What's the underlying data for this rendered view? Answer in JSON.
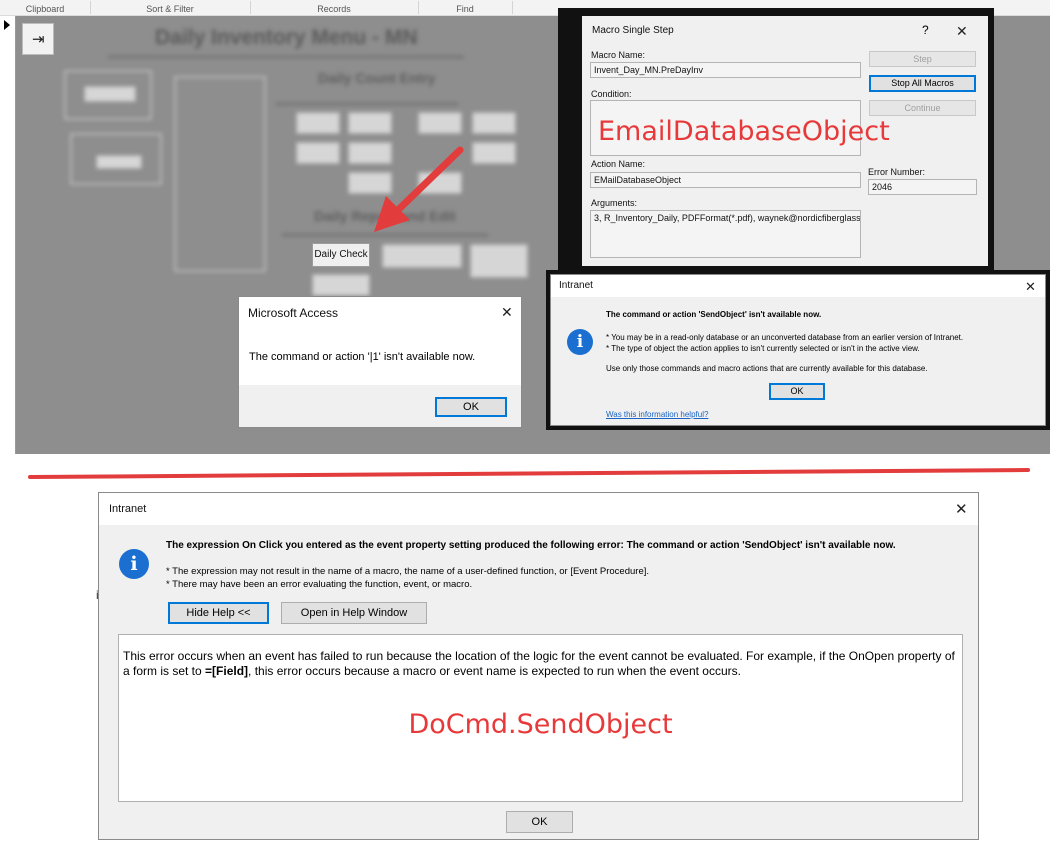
{
  "ribbon": {
    "groups": [
      "Clipboard",
      "Sort & Filter",
      "Records",
      "Find"
    ]
  },
  "access_form": {
    "title": "Daily Inventory Menu - MN",
    "daily_count_heading": "Daily Count Entry",
    "daily_report_heading": "Daily Report and Edit",
    "daily_check_label": "Daily Check"
  },
  "macro_step": {
    "title": "Macro Single Step",
    "help_glyph": "?",
    "close_glyph": "✕",
    "macro_name_label": "Macro Name:",
    "macro_name_value": "Invent_Day_MN.PreDayInv",
    "condition_label": "Condition:",
    "condition_value": "",
    "action_name_label": "Action Name:",
    "action_name_value": "EMailDatabaseObject",
    "error_number_label": "Error Number:",
    "error_number_value": "2046",
    "arguments_label": "Arguments:",
    "arguments_value": "3, R_Inventory_Daily, PDFFormat(*.pdf), waynek@nordicfiberglass",
    "step_btn": "Step",
    "stop_btn": "Stop All Macros",
    "continue_btn": "Continue",
    "annotation": "EmailDatabaseObject"
  },
  "ms_access_dialog": {
    "title": "Microsoft Access",
    "close_glyph": "✕",
    "message": "The command or action '|1' isn't available now.",
    "ok": "OK"
  },
  "intranet_small": {
    "title": "Intranet",
    "close_glyph": "✕",
    "icon_glyph": "i",
    "headline": "The command or action 'SendObject' isn't available now.",
    "bullet1": "* You may be in a read-only database or an unconverted database from an earlier version of Intranet.",
    "bullet2": "* The type of object the action applies to isn't currently selected or isn't in the active view.",
    "note": "Use only those commands and macro actions that are currently available for this database.",
    "ok": "OK",
    "help_link": "Was this information helpful?"
  },
  "intranet_large": {
    "title": "Intranet",
    "close_glyph": "✕",
    "icon_glyph": "i",
    "headline": "The expression On Click you entered as the event property setting produced the following error: The command or action 'SendObject' isn't available now.",
    "bullet1": "* The expression may not result in the name of a macro, the name of a user-defined function, or [Event Procedure].",
    "bullet2": "* There may have been an error evaluating the function, event, or macro.",
    "hide_help_btn": "Hide Help <<",
    "open_help_btn": "Open in Help Window",
    "help_text_1": "This error occurs when an event has failed to run because the location of the logic for the event cannot be evaluated. For example, if the OnOpen property of a form is set to ",
    "help_text_bold": "=[Field]",
    "help_text_2": ", this error occurs because a macro or event name is expected to run when the event occurs.",
    "annotation": "DoCmd.SendObject",
    "ok": "OK"
  },
  "colors": {
    "annotation_red": "#e8393a",
    "info_blue": "#1a6fd0",
    "focus_blue": "#0078d7"
  }
}
